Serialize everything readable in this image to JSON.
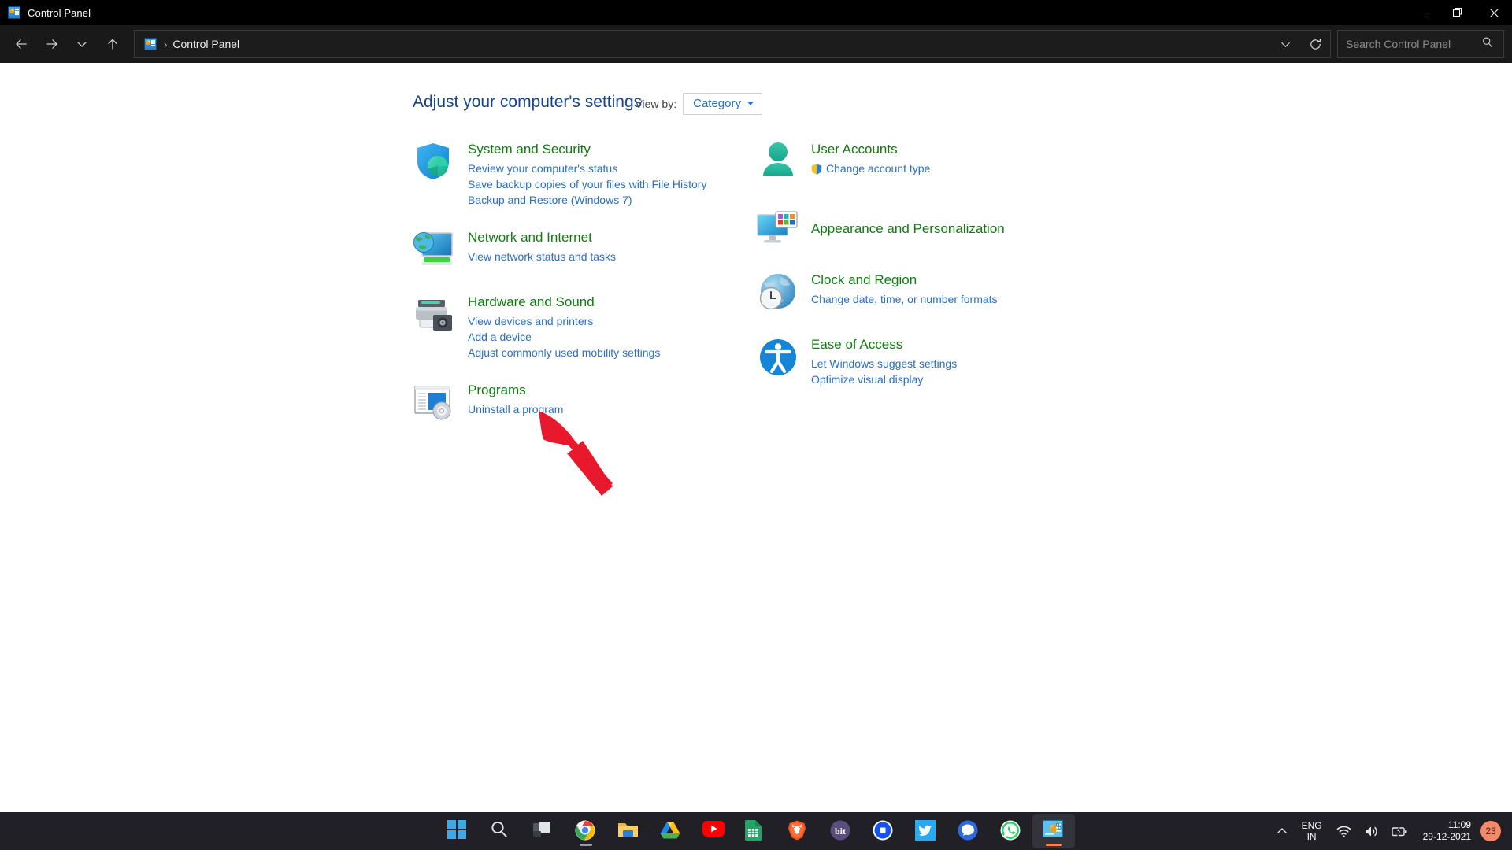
{
  "window": {
    "title": "Control Panel",
    "icon": "control-panel-icon",
    "controls": {
      "minimize": "—",
      "maximize": "❐",
      "close": "✕"
    }
  },
  "nav": {
    "back": "back-arrow",
    "forward": "forward-arrow",
    "recent": "chevron-down",
    "up": "up-arrow",
    "address": {
      "icon": "control-panel-icon",
      "separator": "›",
      "text": "Control Panel",
      "dropdown": "chevron-down",
      "refresh": "refresh-icon"
    },
    "search": {
      "placeholder": "Search Control Panel",
      "icon": "search-icon"
    }
  },
  "main": {
    "heading": "Adjust your computer's settings",
    "view_by": {
      "label": "View by:",
      "value": "Category"
    },
    "left_column": [
      {
        "icon": "security-shield-icon",
        "title": "System and Security",
        "links": [
          "Review your computer's status",
          "Save backup copies of your files with File History",
          "Backup and Restore (Windows 7)"
        ]
      },
      {
        "icon": "network-globe-icon",
        "title": "Network and Internet",
        "links": [
          "View network status and tasks"
        ]
      },
      {
        "icon": "printer-icon",
        "title": "Hardware and Sound",
        "links": [
          "View devices and printers",
          "Add a device",
          "Adjust commonly used mobility settings"
        ]
      },
      {
        "icon": "programs-disc-icon",
        "title": "Programs",
        "links": [
          "Uninstall a program"
        ]
      }
    ],
    "right_column": [
      {
        "icon": "user-account-icon",
        "title": "User Accounts",
        "links": [
          "Change account type"
        ],
        "link_shields": [
          true
        ]
      },
      {
        "icon": "display-personalization-icon",
        "title": "Appearance and Personalization",
        "links": []
      },
      {
        "icon": "clock-region-icon",
        "title": "Clock and Region",
        "links": [
          "Change date, time, or number formats"
        ]
      },
      {
        "icon": "ease-of-access-icon",
        "title": "Ease of Access",
        "links": [
          "Let Windows suggest settings",
          "Optimize visual display"
        ]
      }
    ]
  },
  "annotation": {
    "type": "red-arrow",
    "color": "#E8192C",
    "points_to": "Uninstall a program"
  },
  "taskbar": {
    "items": [
      {
        "name": "start-button",
        "label": "Start"
      },
      {
        "name": "search-taskbar-button",
        "label": "Search"
      },
      {
        "name": "task-view-button",
        "label": "Task View"
      },
      {
        "name": "chrome-taskbar-button",
        "label": "Google Chrome",
        "running": true
      },
      {
        "name": "file-explorer-taskbar-button",
        "label": "File Explorer"
      },
      {
        "name": "google-drive-taskbar-button",
        "label": "Google Drive"
      },
      {
        "name": "youtube-taskbar-button",
        "label": "YouTube"
      },
      {
        "name": "google-sheets-taskbar-button",
        "label": "Google Sheets"
      },
      {
        "name": "brave-taskbar-button",
        "label": "Brave"
      },
      {
        "name": "bit-taskbar-button",
        "label": "Bit"
      },
      {
        "name": "coinbase-taskbar-button",
        "label": "Coinbase"
      },
      {
        "name": "twitter-taskbar-button",
        "label": "Twitter"
      },
      {
        "name": "signal-taskbar-button",
        "label": "Signal"
      },
      {
        "name": "whatsapp-taskbar-button",
        "label": "WhatsApp"
      },
      {
        "name": "control-panel-taskbar-button",
        "label": "Control Panel",
        "active": true
      }
    ],
    "tray": {
      "overflow": "chevron-up",
      "language": {
        "line1": "ENG",
        "line2": "IN"
      },
      "wifi": "wifi-icon",
      "volume": "volume-icon",
      "battery": "battery-charging-icon",
      "time": "11:09",
      "date": "29-12-2021",
      "notification_badge": "23"
    }
  },
  "colors": {
    "title_blue": "#16448C",
    "category_green": "#107C10",
    "link_blue": "#2B6FC0",
    "accent_red": "#E8192C",
    "taskbar_bg": "#202026",
    "chrome_bg": "#191919"
  }
}
